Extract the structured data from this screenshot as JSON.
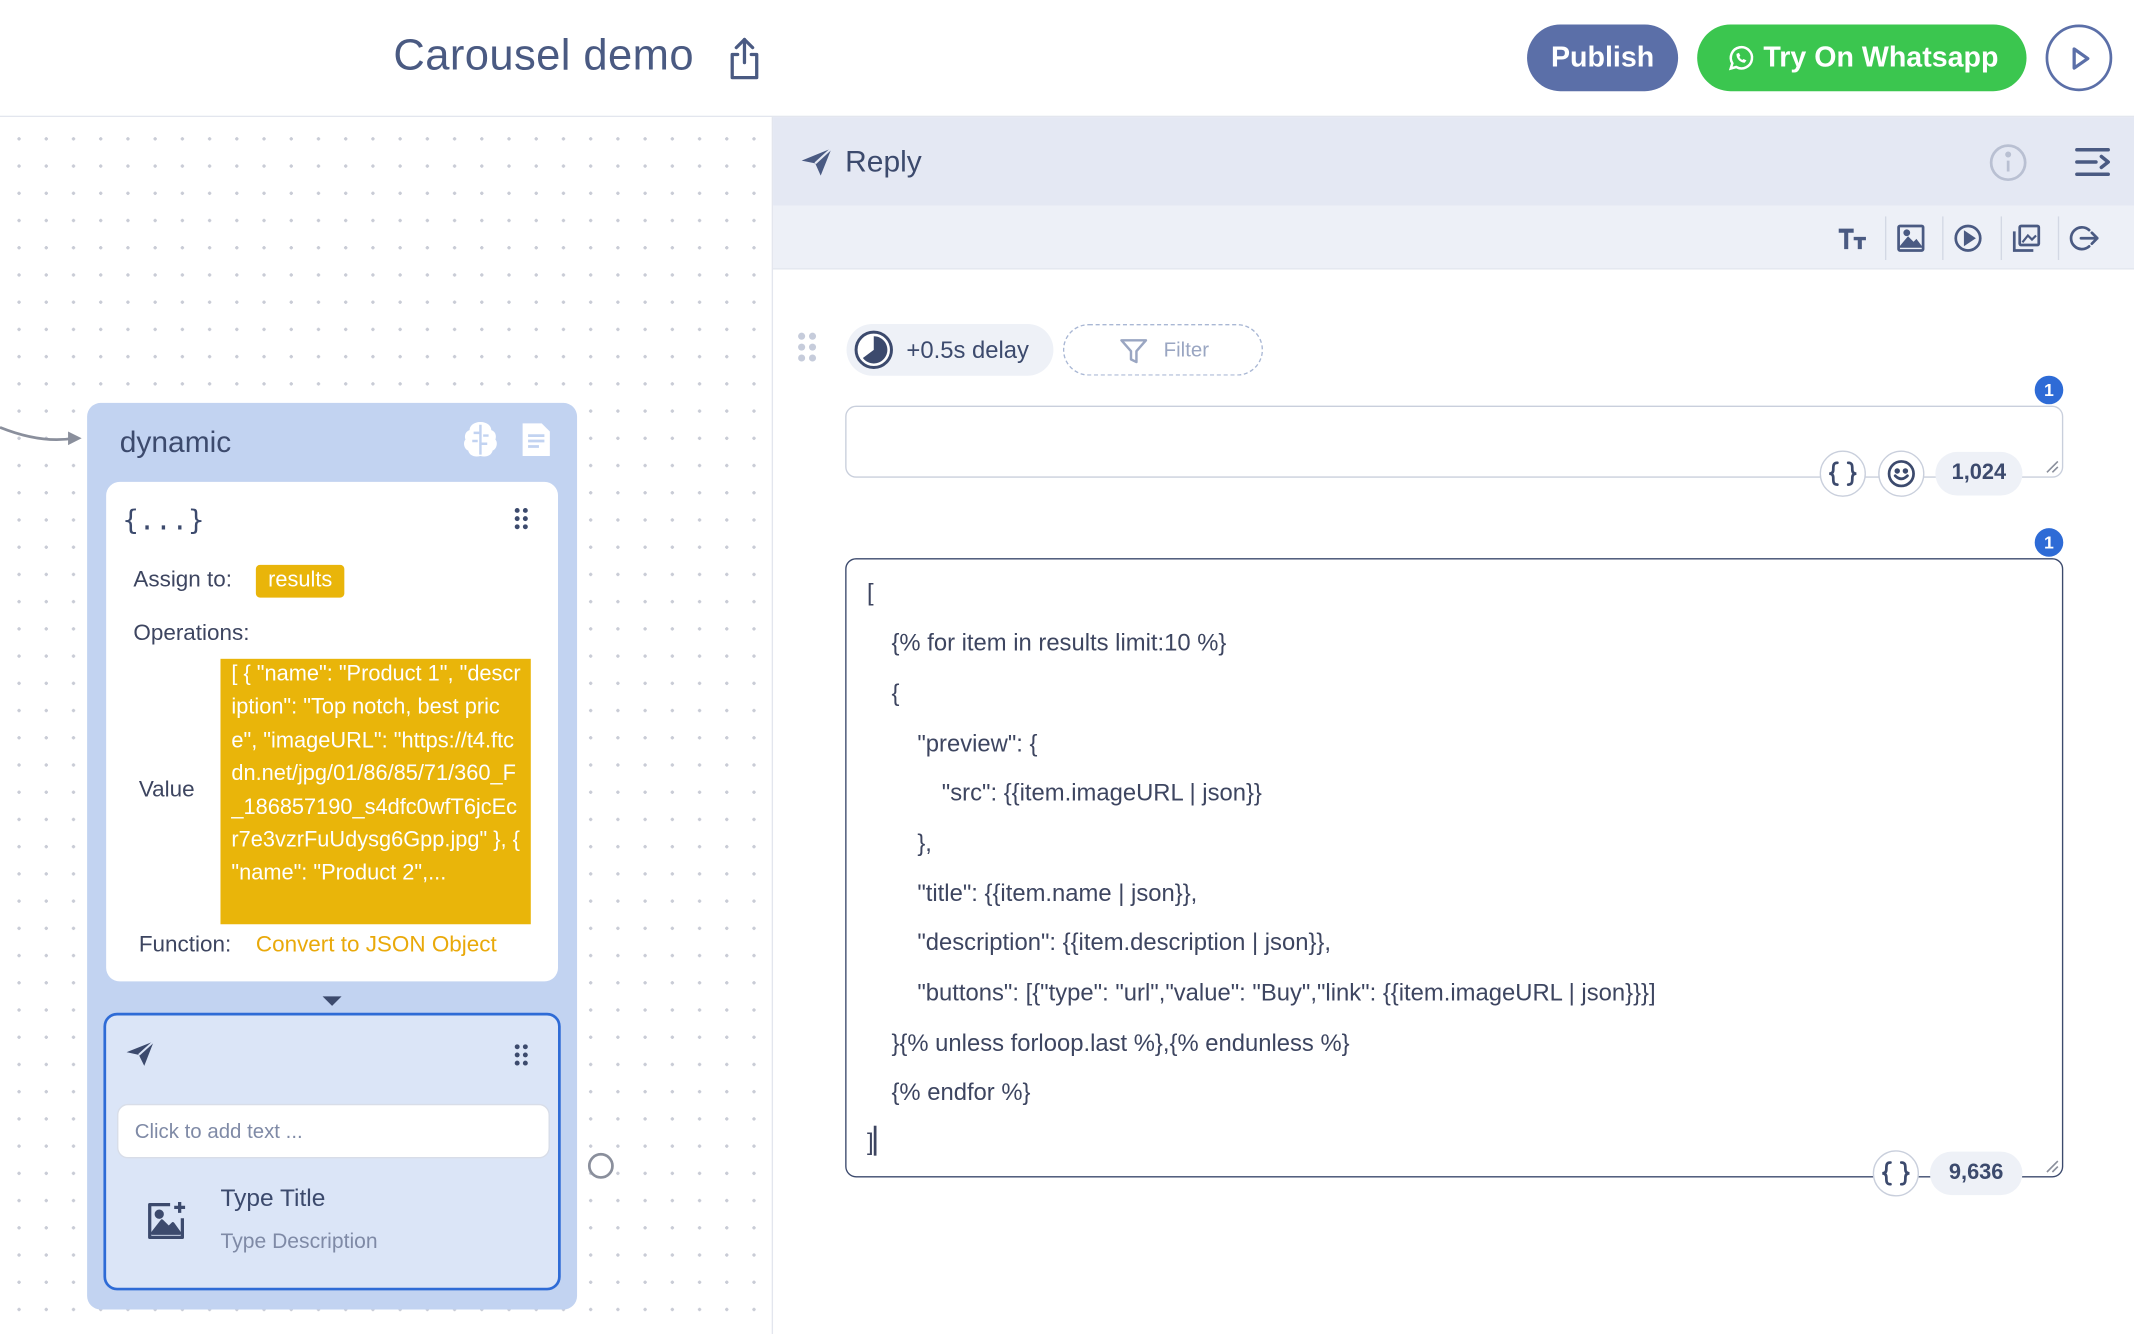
{
  "header": {
    "title": "Carousel demo",
    "publish_label": "Publish",
    "whatsapp_label": "Try On Whatsapp"
  },
  "node": {
    "title": "dynamic",
    "operation": {
      "assign_label": "Assign to:",
      "assign_value": "results",
      "operations_label": "Operations:",
      "value_label": "Value",
      "value_text": "[ { \"name\": \"Product 1\", \"description\": \"Top notch, best price\", \"imageURL\": \"https://t4.ftcdn.net/jpg/01/86/85/71/360_F_186857190_s4dfc0wfT6jcEcr7e3vzrFuUdysg6Gpp.jpg\" }, { \"name\": \"Product 2\",...",
      "function_label": "Function:",
      "function_value": "Convert to JSON Object"
    },
    "reply": {
      "text_placeholder": "Click to add text ...",
      "type_title": "Type Title",
      "type_description": "Type Description"
    }
  },
  "panel": {
    "title": "Reply",
    "delay_label": "+0.5s delay",
    "filter_label": "Filter",
    "badge_1": "1",
    "badge_2": "1",
    "text_counter": "1,024",
    "code_counter": "9,636",
    "code_lines": [
      "[",
      "{% for item in results limit:10 %}",
      "{",
      "\"preview\": {",
      "\"src\": {{item.imageURL | json}}",
      "},",
      "\"title\": {{item.name | json}},",
      "\"description\": {{item.description | json}},",
      "\"buttons\": [{\"type\": \"url\",\"value\": \"Buy\",\"link\": {{item.imageURL | json}}}]",
      "}{% unless forloop.last %},{% endunless %}",
      "{% endfor %}",
      "]"
    ]
  },
  "colors": {
    "accent": "#5b6fa8",
    "whatsapp": "#3bc64f",
    "highlight": "#e9b50a",
    "focus": "#2e6bd6"
  }
}
